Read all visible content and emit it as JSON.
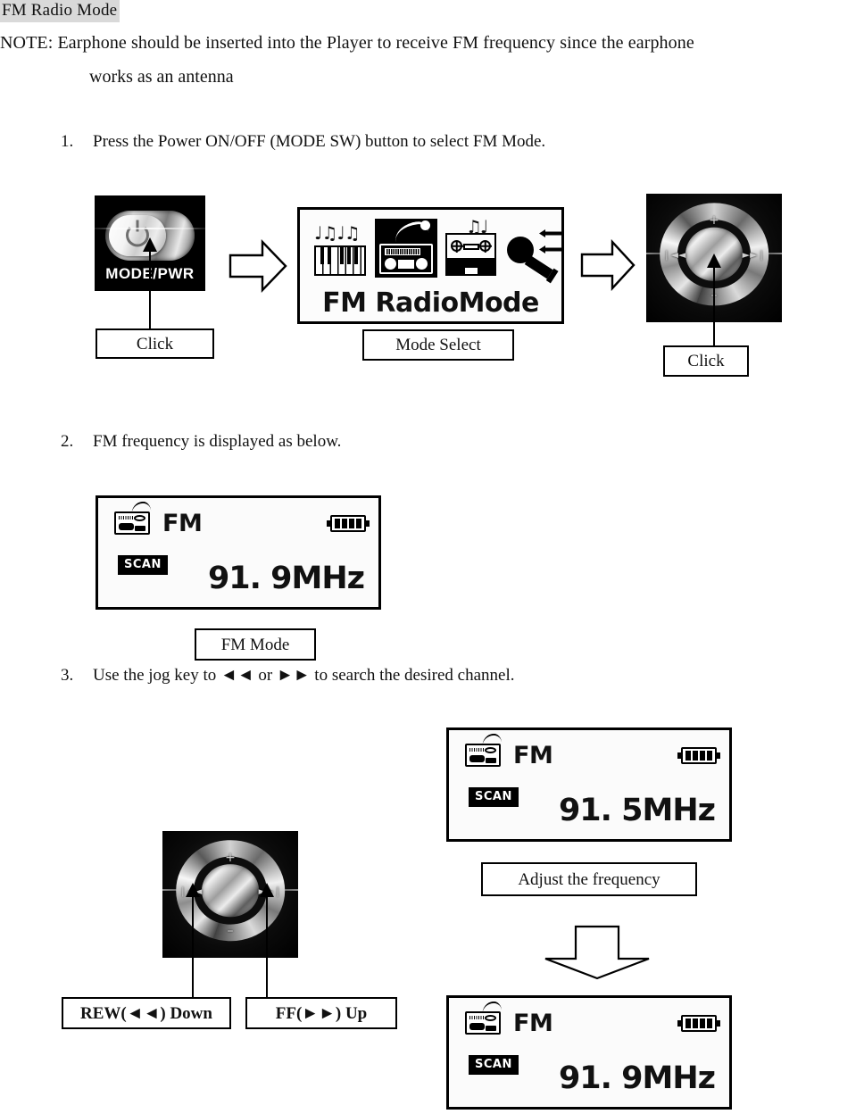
{
  "heading": "FM Radio Mode",
  "note": {
    "line1": "NOTE: Earphone should be inserted into the Player to receive FM frequency since the earphone",
    "line2": "works as an antenna"
  },
  "steps": [
    {
      "num": "1.",
      "text": "Press the Power ON/OFF (MODE SW) button to select FM Mode."
    },
    {
      "num": "2.",
      "text": "FM frequency is displayed as below."
    },
    {
      "num": "3.",
      "text": "Use the jog key to  ◄◄  or  ►►  to search the desired channel."
    }
  ],
  "step1": {
    "power_button": {
      "caption": "MODE/PWR",
      "label": "Click"
    },
    "mode_display": {
      "title": "FM  RadioMode",
      "label": "Mode Select",
      "icons": [
        "piano-music-icon",
        "radio-icon",
        "cassette-icon",
        "microphone-icon"
      ]
    },
    "jog_dial": {
      "label": "Click",
      "marks": {
        "up": "+",
        "down": "–",
        "prev": "❘◄◄",
        "next": "►►❘"
      }
    }
  },
  "step2": {
    "display": {
      "mode": "FM",
      "badge": "SCAN",
      "frequency": "91. 9MHz",
      "battery_bars": 4
    },
    "label": "FM Mode"
  },
  "step3": {
    "jog_dial": {
      "marks": {
        "up": "+",
        "down": "–",
        "prev": "❘◄◄",
        "next": "►►❘"
      }
    },
    "rew_label": "REW(◄◄) Down",
    "ff_label": "FF(►►) Up",
    "display_before": {
      "mode": "FM",
      "badge": "SCAN",
      "frequency": "91. 5MHz",
      "battery_bars": 4
    },
    "adjust_label": "Adjust the frequency",
    "display_after": {
      "mode": "FM",
      "badge": "SCAN",
      "frequency": "91. 9MHz",
      "battery_bars": 4
    }
  }
}
